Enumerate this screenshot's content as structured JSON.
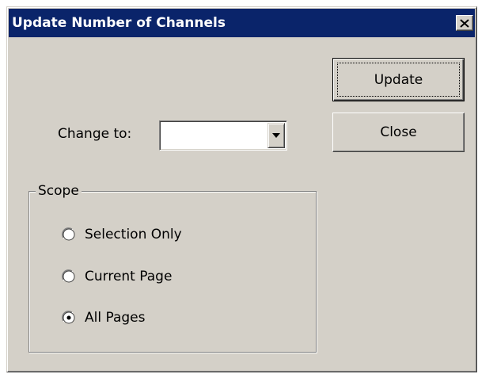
{
  "dialog": {
    "title": "Update Number of Channels",
    "close_glyph": "✕"
  },
  "buttons": {
    "update_label": "Update",
    "close_label": "Close"
  },
  "change_to": {
    "label": "Change to:",
    "value": ""
  },
  "scope": {
    "legend": "Scope",
    "options": [
      {
        "label": "Selection Only",
        "selected": false
      },
      {
        "label": "Current Page",
        "selected": false
      },
      {
        "label": "All Pages",
        "selected": true
      }
    ]
  },
  "colors": {
    "title_bar": "#0a246a",
    "dialog_face": "#d4d0c8"
  }
}
